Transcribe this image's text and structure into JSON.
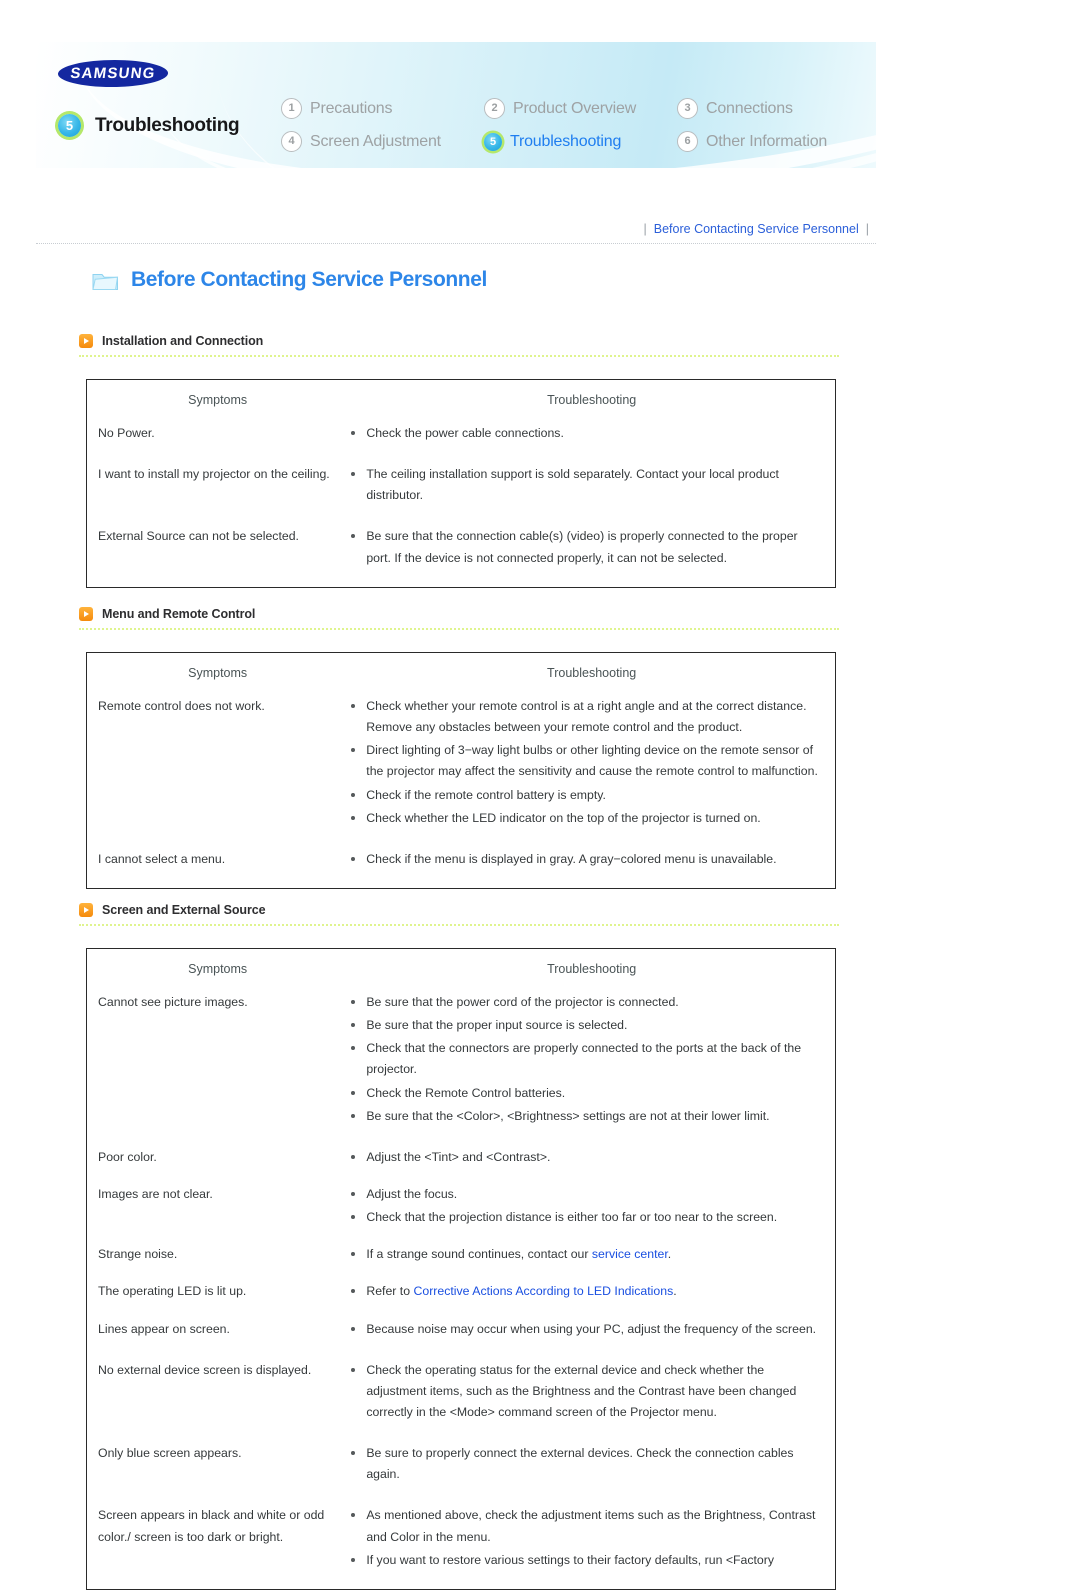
{
  "header": {
    "brand": "SAMSUNG",
    "current_section_number": "5",
    "current_section_label": "Troubleshooting",
    "nav_items": [
      {
        "number": "1",
        "label": "Precautions",
        "active": false
      },
      {
        "number": "2",
        "label": "Product Overview",
        "active": false
      },
      {
        "number": "3",
        "label": "Connections",
        "active": false
      },
      {
        "number": "4",
        "label": "Screen Adjustment",
        "active": false
      },
      {
        "number": "5",
        "label": "Troubleshooting",
        "active": true
      },
      {
        "number": "6",
        "label": "Other Information",
        "active": false
      }
    ]
  },
  "breadcrumb": {
    "separator": "|",
    "current": "Before Contacting Service Personnel"
  },
  "page": {
    "title": "Before Contacting Service Personnel",
    "icon": "folder-icon"
  },
  "table_headers": {
    "symptoms": "Symptoms",
    "troubleshooting": "Troubleshooting"
  },
  "sections": [
    {
      "id": "installation-and-connection",
      "title": "Installation and Connection",
      "rows": [
        {
          "symptom": "No Power.",
          "fixes": [
            {
              "text": "Check the power cable connections."
            }
          ]
        },
        {
          "symptom": "I want to install my projector on the ceiling.",
          "fixes": [
            {
              "text": "The ceiling installation support is sold separately. Contact your local product distributor."
            }
          ]
        },
        {
          "symptom": "External Source can not be selected.",
          "fixes": [
            {
              "text": "Be sure that the connection cable(s) (video) is properly connected to the proper port. If the device is not connected properly, it can not be selected."
            }
          ]
        }
      ]
    },
    {
      "id": "menu-and-remote-control",
      "title": "Menu and Remote Control",
      "rows": [
        {
          "symptom": "Remote control does not work.",
          "fixes": [
            {
              "text": "Check whether your remote control is at a right angle and at the correct distance. Remove any obstacles between your remote control and the product."
            },
            {
              "text": "Direct lighting of 3−way light bulbs or other lighting device on the remote sensor of the projector may affect the sensitivity and cause the remote control to malfunction."
            },
            {
              "text": "Check if the remote control battery is empty."
            },
            {
              "text": "Check whether the LED indicator on the top of the projector is turned on."
            }
          ]
        },
        {
          "symptom": "I cannot select a menu.",
          "fixes": [
            {
              "text": "Check if the menu is displayed in gray. A gray−colored menu is unavailable."
            }
          ]
        }
      ]
    },
    {
      "id": "screen-and-external-source",
      "title": "Screen and External Source",
      "rows": [
        {
          "symptom": "Cannot see picture images.",
          "fixes": [
            {
              "text": "Be sure that the power cord of the projector is connected."
            },
            {
              "text": "Be sure that the proper input source is selected."
            },
            {
              "text": "Check that the connectors are properly connected to the ports at the back of the projector."
            },
            {
              "text": "Check the Remote Control batteries."
            },
            {
              "text": "Be sure that the <Color>, <Brightness> settings are not at their lower limit."
            }
          ]
        },
        {
          "symptom": "Poor color.",
          "fixes": [
            {
              "text": "Adjust the <Tint> and <Contrast>."
            }
          ]
        },
        {
          "symptom": "Images are not clear.",
          "fixes": [
            {
              "text": "Adjust the focus."
            },
            {
              "text": "Check that the projection distance is either too far or too near to the screen."
            }
          ]
        },
        {
          "symptom": "Strange noise.",
          "fixes": [
            {
              "prefix": "If a strange sound continues, contact our ",
              "link": "service center",
              "suffix": "."
            }
          ]
        },
        {
          "symptom": "The operating LED is lit up.",
          "fixes": [
            {
              "prefix": "Refer to ",
              "link": "Corrective Actions According to LED Indications",
              "suffix": "."
            }
          ]
        },
        {
          "symptom": "Lines appear on screen.",
          "fixes": [
            {
              "text": "Because noise may occur when using your PC, adjust the frequency of the screen."
            }
          ]
        },
        {
          "symptom": "No external device screen is displayed.",
          "fixes": [
            {
              "text": "Check the operating status for the external device and check whether the adjustment items, such as the Brightness and the Contrast have been changed correctly in the <Mode> command screen of the Projector menu."
            }
          ]
        },
        {
          "symptom": "Only blue screen appears.",
          "fixes": [
            {
              "text": "Be sure to properly connect the external devices. Check the connection cables again."
            }
          ]
        },
        {
          "symptom": "Screen appears in black and white or odd color./ screen is too dark or bright.",
          "fixes": [
            {
              "text": "As mentioned above, check the adjustment items such as the Brightness, Contrast and Color in the menu."
            },
            {
              "text": "If you want to restore various settings to their factory defaults, run <Factory"
            }
          ]
        }
      ]
    }
  ],
  "colors": {
    "link": "#1a4fe0",
    "nav_active": "#1f7ef0",
    "title": "#2d86e8",
    "accent_orange": "#f58a0c",
    "accent_green": "#b5e86a",
    "brand_blue": "#1428a0"
  }
}
